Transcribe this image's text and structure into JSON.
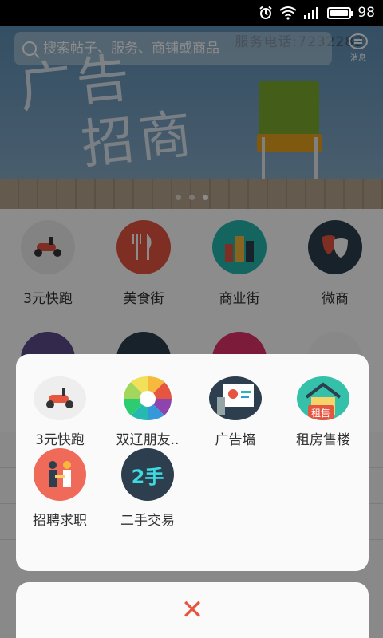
{
  "status": {
    "battery": "98",
    "battery_level": 0.98
  },
  "search": {
    "placeholder": "搜索帖子、服务、商铺或商品"
  },
  "header": {
    "message_label": "消息"
  },
  "banner": {
    "text_line1": "广告",
    "text_line2": "招商",
    "phone": "服务电话:7232282"
  },
  "grid": {
    "row1": [
      {
        "label": "3元快跑",
        "icon": "scooter-icon",
        "color": "#eeeeee"
      },
      {
        "label": "美食街",
        "icon": "fork-knife-icon",
        "color": "#e5553f"
      },
      {
        "label": "商业街",
        "icon": "buildings-icon",
        "color": "#26b9b0"
      },
      {
        "label": "微商",
        "icon": "theater-mask-icon",
        "color": "#2d3e4e"
      }
    ],
    "row2": [
      {
        "icon": "newspaper-icon",
        "color": "#5b4b8a"
      },
      {
        "icon": "app-grid-icon",
        "color": "#2d3e4e"
      },
      {
        "icon": "house-icon",
        "color": "#e2336b"
      },
      {
        "icon": "aperture-icon",
        "color": "#ffffff"
      }
    ]
  },
  "sheet": {
    "items": [
      {
        "label": "3元快跑",
        "icon": "scooter-icon",
        "color": "#eeeeee"
      },
      {
        "label": "双辽朋友..",
        "icon": "aperture-icon",
        "color": "#ffffff"
      },
      {
        "label": "广告墙",
        "icon": "presentation-icon",
        "color": "#2d3e4e"
      },
      {
        "label": "租房售楼",
        "icon": "house-rent-icon",
        "color": "#35c1a9",
        "badge": "租售"
      },
      {
        "label": "招聘求职",
        "icon": "handshake-icon",
        "color": "#f06a5a"
      },
      {
        "label": "二手交易",
        "icon": "second-hand-icon",
        "color": "#2d3e4e",
        "badge": "2手"
      }
    ]
  },
  "close": {
    "icon": "close-icon",
    "glyph": "✕"
  }
}
